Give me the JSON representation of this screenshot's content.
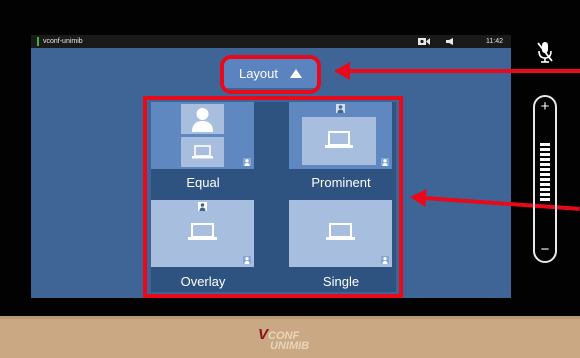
{
  "status_bar": {
    "title": "vconf-unimib",
    "time": "11:42"
  },
  "layout_button": {
    "label": "Layout"
  },
  "tiles": [
    {
      "id": "equal",
      "label": "Equal"
    },
    {
      "id": "prominent",
      "label": "Prominent"
    },
    {
      "id": "overlay",
      "label": "Overlay"
    },
    {
      "id": "single",
      "label": "Single"
    }
  ],
  "volume": {
    "plus": "+",
    "minus": "−",
    "level_bars": 12
  },
  "logo": {
    "text_v": "V",
    "text_conf": "CONF",
    "text_unimib": "UNIMIB"
  },
  "colors": {
    "annotation": "#e8091b",
    "screen": "#3f6596",
    "tile": "#5f88c0",
    "footer": "#c9a883"
  },
  "icons": [
    "camera-icon",
    "speaker-icon",
    "mic-muted-icon",
    "person-icon",
    "laptop-icon",
    "triangle-up-icon"
  ]
}
